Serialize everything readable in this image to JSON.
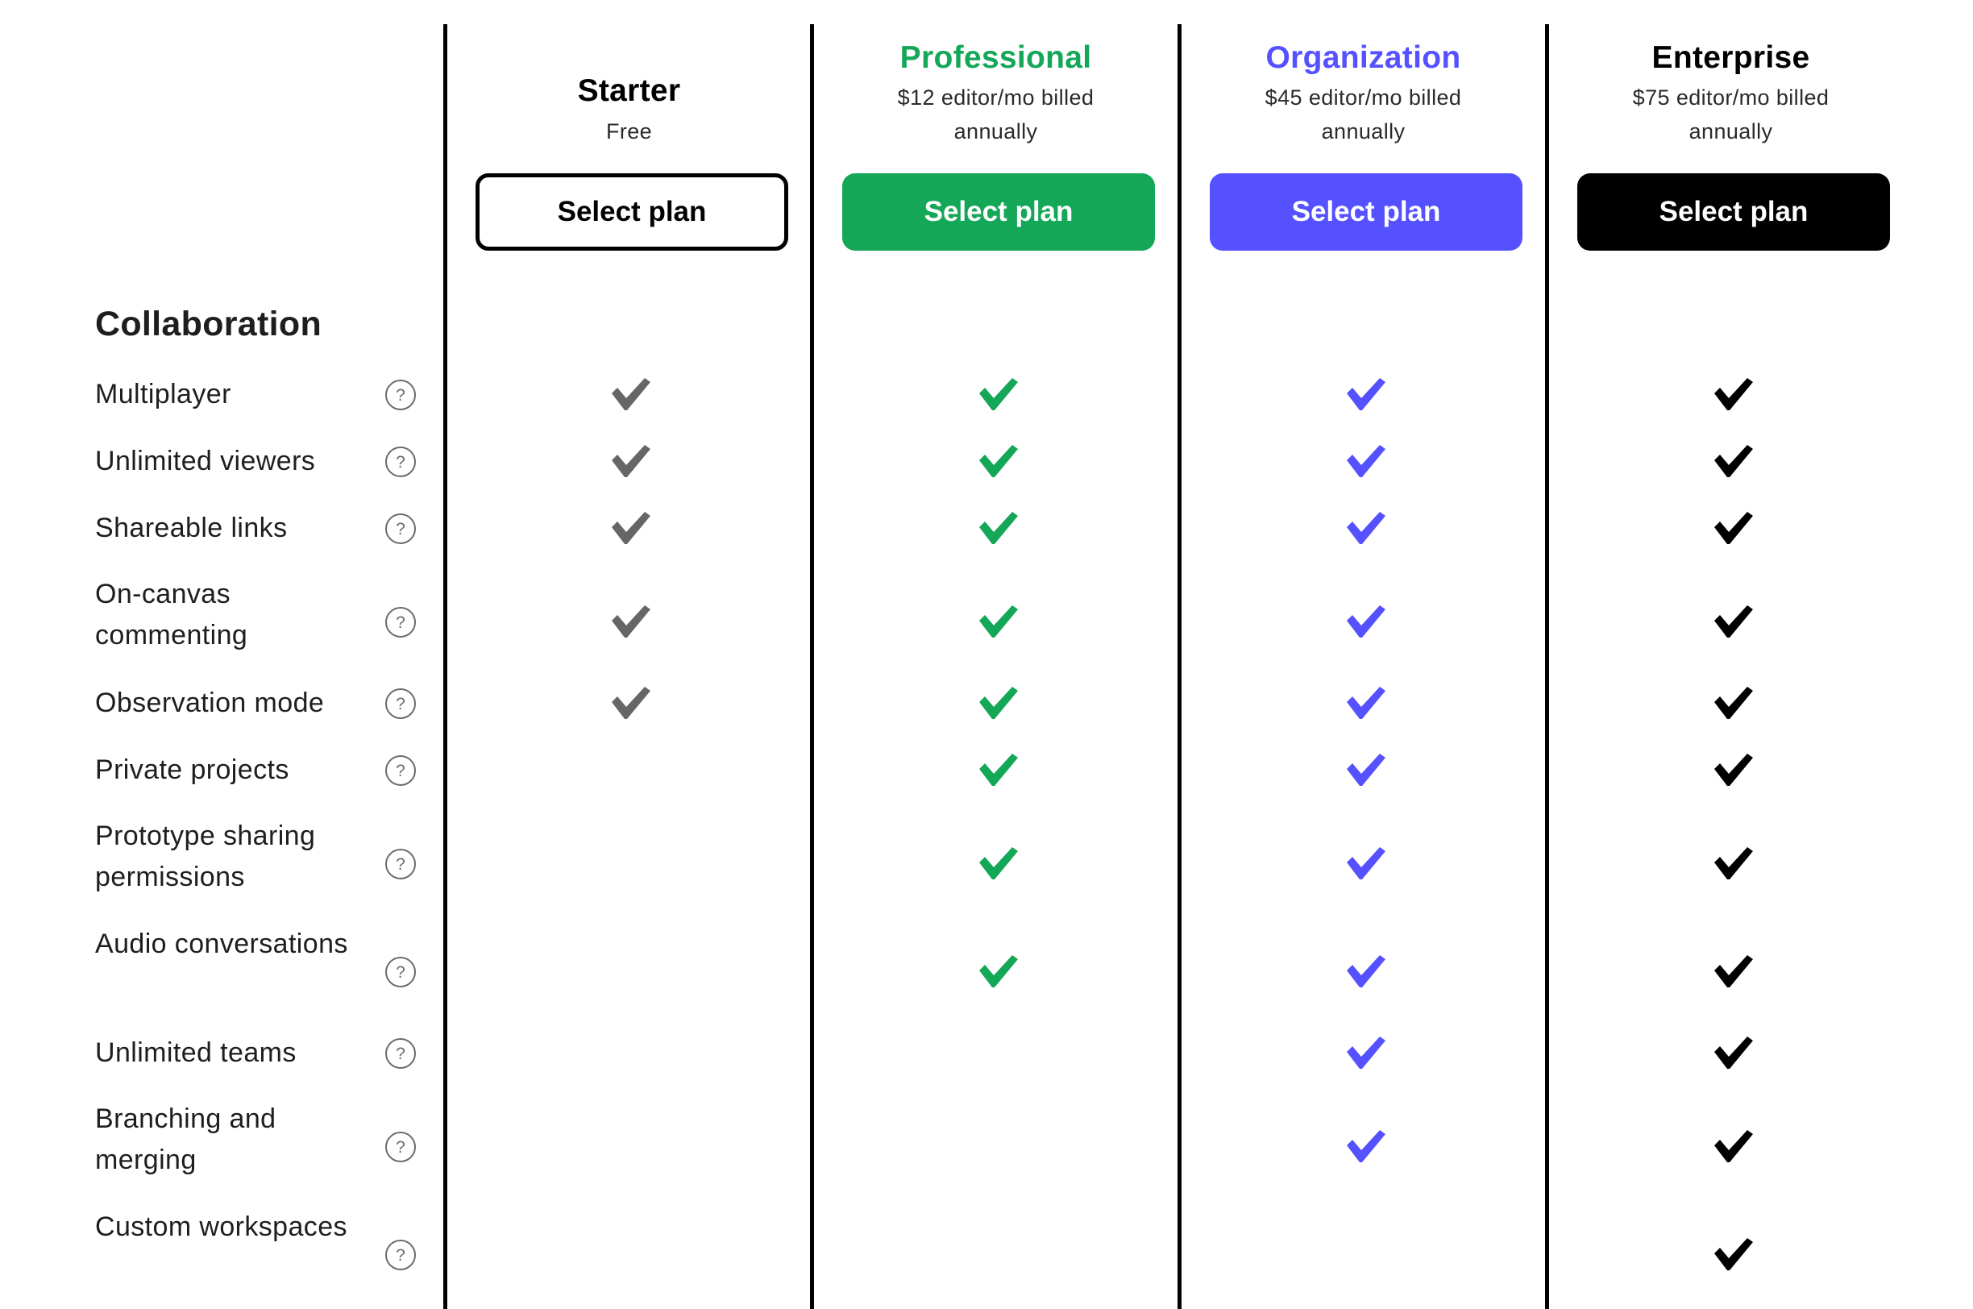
{
  "plans": [
    {
      "name": "Starter",
      "price_line1": "Free",
      "price_line2": "",
      "button_label": "Select plan",
      "accent": "#000000",
      "check_color": "#666666",
      "button_style": "outline"
    },
    {
      "name": "Professional",
      "price_line1": "$12 editor/mo billed",
      "price_line2": "annually",
      "button_label": "Select plan",
      "accent": "#14A758",
      "check_color": "#14A758",
      "button_style": "filled"
    },
    {
      "name": "Organization",
      "price_line1": "$45 editor/mo billed",
      "price_line2": "annually",
      "button_label": "Select plan",
      "accent": "#5551FF",
      "check_color": "#5551FF",
      "button_style": "filled"
    },
    {
      "name": "Enterprise",
      "price_line1": "$75 editor/mo billed",
      "price_line2": "annually",
      "button_label": "Select plan",
      "accent": "#000000",
      "check_color": "#000000",
      "button_style": "filled"
    }
  ],
  "section": {
    "title": "Collaboration",
    "features": [
      {
        "label": "Multiplayer",
        "lines": 1,
        "included": [
          true,
          true,
          true,
          true
        ]
      },
      {
        "label": "Unlimited viewers",
        "lines": 1,
        "included": [
          true,
          true,
          true,
          true
        ]
      },
      {
        "label": "Shareable links",
        "lines": 1,
        "included": [
          true,
          true,
          true,
          true
        ]
      },
      {
        "label": "On-canvas commenting",
        "lines": 2,
        "included": [
          true,
          true,
          true,
          true
        ]
      },
      {
        "label": "Observation mode",
        "lines": 1,
        "included": [
          true,
          true,
          true,
          true
        ]
      },
      {
        "label": "Private projects",
        "lines": 1,
        "included": [
          false,
          true,
          true,
          true
        ]
      },
      {
        "label": "Prototype sharing permissions",
        "lines": 2,
        "included": [
          false,
          true,
          true,
          true
        ]
      },
      {
        "label": "Audio conversations",
        "lines": 2,
        "included": [
          false,
          true,
          true,
          true
        ]
      },
      {
        "label": "Unlimited teams",
        "lines": 1,
        "included": [
          false,
          false,
          true,
          true
        ]
      },
      {
        "label": "Branching and merging",
        "lines": 2,
        "included": [
          false,
          false,
          true,
          true
        ]
      },
      {
        "label": "Custom workspaces",
        "lines": 2,
        "included": [
          false,
          false,
          false,
          true
        ]
      }
    ]
  },
  "icons": {
    "help": "help-circle-icon",
    "check": "checkmark-icon"
  }
}
